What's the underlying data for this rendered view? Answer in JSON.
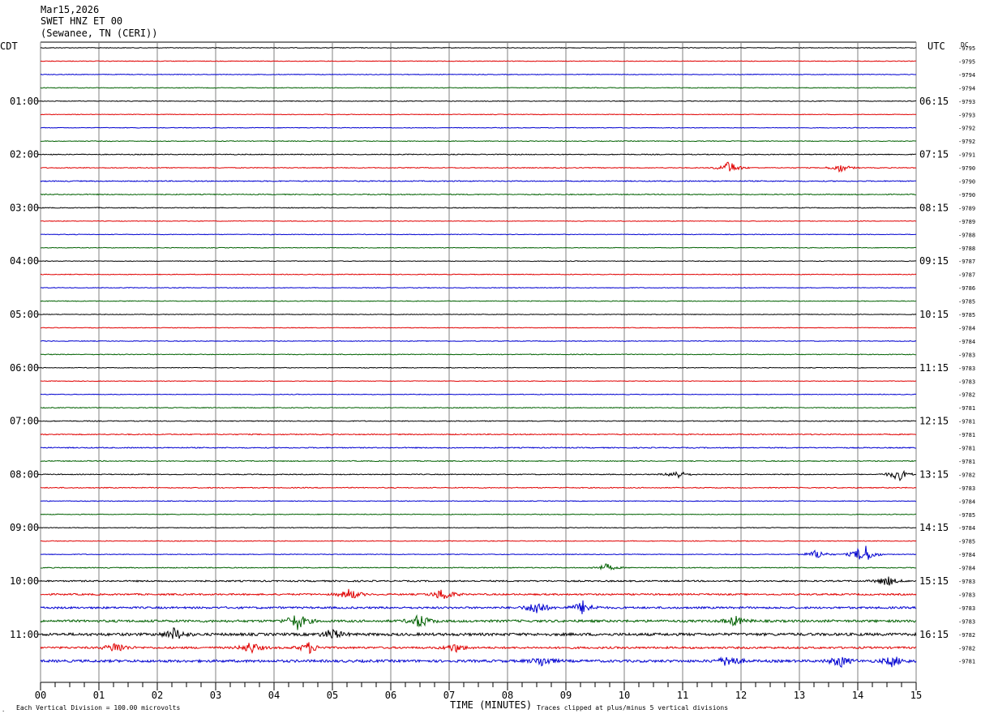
{
  "header": {
    "date": "Mar15,2026",
    "station": "SWET HNZ ET 00",
    "location": "(Sewanee, TN (CERI))"
  },
  "left_axis_label": "CDT",
  "right_axis_label": "UTC",
  "dc_label": "DC",
  "left_hour_labels": [
    "01:00",
    "02:00",
    "03:00",
    "04:00",
    "05:00",
    "06:00",
    "07:00",
    "08:00",
    "09:00",
    "10:00",
    "11:00"
  ],
  "right_hour_labels": [
    "06:15",
    "07:15",
    "08:15",
    "09:15",
    "10:15",
    "11:15",
    "12:15",
    "13:15",
    "14:15",
    "15:15",
    "16:15"
  ],
  "dc_offsets": [
    "-9795",
    "-9795",
    "-9794",
    "-9794",
    "-9793",
    "-9793",
    "-9792",
    "-9792",
    "-9791",
    "-9790",
    "-9790",
    "-9790",
    "-9789",
    "-9789",
    "-9788",
    "-9788",
    "-9787",
    "-9787",
    "-9786",
    "-9785",
    "-9785",
    "-9784",
    "-9784",
    "-9783",
    "-9783",
    "-9783",
    "-9782",
    "-9781",
    "-9781",
    "-9781",
    "-9781",
    "-9781",
    "-9782",
    "-9783",
    "-9784",
    "-9785",
    "-9784",
    "-9785",
    "-9784",
    "-9784",
    "-9783",
    "-9783",
    "-9783",
    "-9783",
    "-9782",
    "-9782",
    "-9781"
  ],
  "x_ticks": [
    "00",
    "01",
    "02",
    "03",
    "04",
    "05",
    "06",
    "07",
    "08",
    "09",
    "10",
    "11",
    "12",
    "13",
    "14",
    "15"
  ],
  "x_axis_title": "TIME (MINUTES)",
  "footer_left": "Each Vertical Division =  100.00 microvolts",
  "footer_right": "Traces clipped at plus/minus 5 vertical divisions",
  "colors": {
    "trace_cycle": [
      "#000000",
      "#e00000",
      "#0000d0",
      "#006000"
    ],
    "grid": "#808080"
  },
  "chart_data": {
    "type": "line",
    "title": "",
    "xlabel": "TIME (MINUTES)",
    "xlim": [
      0,
      15
    ],
    "trace_count": 47,
    "trace_minutes_per_line": 15,
    "grid": true,
    "events": [
      {
        "trace": 10,
        "minute": 11.8,
        "amplitude": 1.3
      },
      {
        "trace": 10,
        "minute": 13.7,
        "amplitude": 0.8
      },
      {
        "trace": 33,
        "minute": 10.9,
        "amplitude": 0.8
      },
      {
        "trace": 33,
        "minute": 14.7,
        "amplitude": 1.2
      },
      {
        "trace": 39,
        "minute": 14.1,
        "amplitude": 2.2
      },
      {
        "trace": 39,
        "minute": 13.3,
        "amplitude": 0.9
      },
      {
        "trace": 40,
        "minute": 9.7,
        "amplitude": 0.7
      },
      {
        "trace": 41,
        "minute": 14.5,
        "amplitude": 1.0
      },
      {
        "trace": 42,
        "minute": 5.3,
        "amplitude": 1.1
      },
      {
        "trace": 42,
        "minute": 6.9,
        "amplitude": 1.3
      },
      {
        "trace": 43,
        "minute": 8.5,
        "amplitude": 1.4
      },
      {
        "trace": 43,
        "minute": 9.3,
        "amplitude": 1.3
      },
      {
        "trace": 44,
        "minute": 4.4,
        "amplitude": 1.6
      },
      {
        "trace": 44,
        "minute": 6.5,
        "amplitude": 1.3
      },
      {
        "trace": 44,
        "minute": 11.9,
        "amplitude": 0.9
      },
      {
        "trace": 45,
        "minute": 2.3,
        "amplitude": 1.2
      },
      {
        "trace": 45,
        "minute": 5.0,
        "amplitude": 1.0
      },
      {
        "trace": 46,
        "minute": 1.3,
        "amplitude": 1.1
      },
      {
        "trace": 46,
        "minute": 3.6,
        "amplitude": 1.1
      },
      {
        "trace": 46,
        "minute": 4.6,
        "amplitude": 1.0
      },
      {
        "trace": 46,
        "minute": 7.1,
        "amplitude": 0.8
      },
      {
        "trace": 47,
        "minute": 8.6,
        "amplitude": 1.0
      },
      {
        "trace": 47,
        "minute": 11.8,
        "amplitude": 1.3
      },
      {
        "trace": 47,
        "minute": 13.7,
        "amplitude": 1.1
      },
      {
        "trace": 47,
        "minute": 14.6,
        "amplitude": 1.0
      }
    ],
    "noise_levels": [
      0.2,
      0.18,
      0.18,
      0.2,
      0.2,
      0.18,
      0.18,
      0.2,
      0.25,
      0.22,
      0.28,
      0.25,
      0.22,
      0.18,
      0.18,
      0.18,
      0.18,
      0.2,
      0.18,
      0.2,
      0.18,
      0.18,
      0.2,
      0.22,
      0.18,
      0.18,
      0.18,
      0.22,
      0.25,
      0.28,
      0.28,
      0.25,
      0.25,
      0.25,
      0.2,
      0.2,
      0.2,
      0.2,
      0.2,
      0.25,
      0.4,
      0.45,
      0.55,
      0.65,
      0.75,
      0.55,
      0.7,
      0.75
    ]
  }
}
